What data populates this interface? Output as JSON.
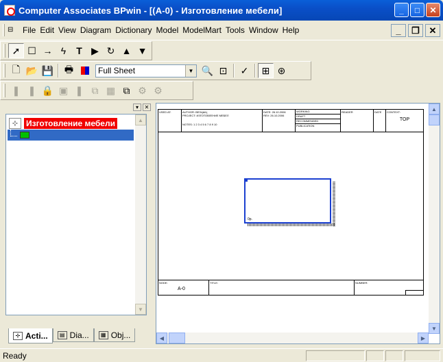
{
  "window": {
    "title": "Computer Associates BPwin - [(A-0)  - Изготовление мебели]",
    "min_glyph": "_",
    "max_glyph": "□",
    "close_glyph": "✕"
  },
  "menu": {
    "items": [
      "File",
      "Edit",
      "View",
      "Diagram",
      "Dictionary",
      "Model",
      "ModelMart",
      "Tools",
      "Window",
      "Help"
    ],
    "mdi_min": "_",
    "mdi_restore": "❐",
    "mdi_close": "✕"
  },
  "toolbar_zoom": {
    "value": "Full Sheet"
  },
  "model_explorer": {
    "root_label": "Изготовление мебели",
    "tabs": [
      "Acti...",
      "Dia...",
      "Obj..."
    ]
  },
  "diagram": {
    "frame": {
      "used_at": "USED AT:",
      "author": "AUTHOR: ВЕЗЦЫЦ",
      "project": "PROJECT: ИЗГОТОВЛЕНИЕ МЕБЕЛ",
      "date": "DATE: 26.10.2006",
      "rev": "REV:   26.10.2006",
      "notes": "NOTES: 1 2 3 4 5 6 7 8 9 10",
      "status": [
        "WORKING",
        "DRAFT",
        "RECOMMENDED",
        "PUBLICATION"
      ],
      "reader": "READER",
      "date2": "DATE",
      "context": "CONTEXT:",
      "context_value": "TOP",
      "node": "NODE:",
      "node_value": "A-0",
      "title": "TITLE:",
      "number": "NUMBER:"
    },
    "box_label": "0р."
  },
  "status": {
    "text": "Ready"
  }
}
